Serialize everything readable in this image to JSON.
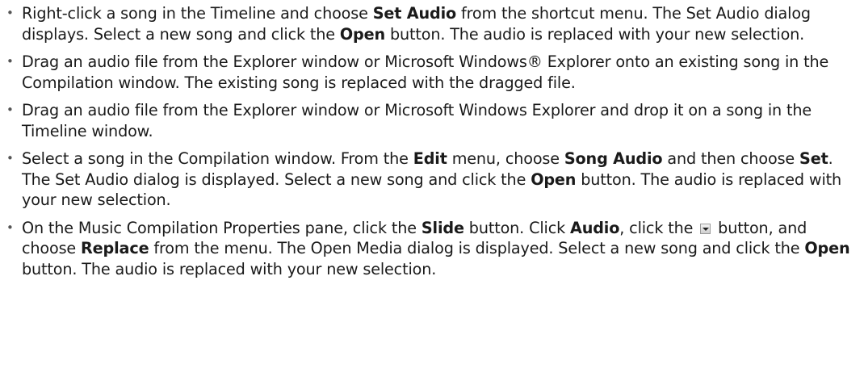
{
  "bullet_char": "•",
  "items": [
    {
      "t1": "Right-click a song in the Timeline and choose ",
      "b1": "Set Audio",
      "t2": " from the shortcut menu. The Set Audio dialog displays. Select a new song and click the ",
      "b2": "Open",
      "t3": " button. The audio is replaced with your new selection."
    },
    {
      "t1": "Drag an audio file from the Explorer window or Microsoft Windows® Explorer onto an existing song in the Compilation window. The existing song is replaced with the dragged file."
    },
    {
      "t1": "Drag an audio file from the Explorer window or Microsoft Windows Explorer and drop it on a song in the Timeline window."
    },
    {
      "t1": "Select a song in the Compilation window. From the ",
      "b1": "Edit",
      "t2": " menu, choose ",
      "b2": "Song Audio",
      "t3": " and then choose ",
      "b3": "Set",
      "t4": ". The Set Audio dialog is displayed. Select a new song and click the ",
      "b4": "Open",
      "t5": " button. The audio is replaced with your new selection."
    },
    {
      "t1": "On the Music Compilation Properties pane, click the ",
      "b1": "Slide",
      "t2": " button. Click ",
      "b2": "Audio",
      "t3": ", click the ",
      "icon": "dropdown-arrow-icon",
      "t4": " button, and choose ",
      "b3": "Replace",
      "t5": " from the menu. The Open Media dialog is displayed. Select a new song and click the ",
      "b4": "Open",
      "t6": " button. The audio is replaced with your new selection."
    }
  ]
}
